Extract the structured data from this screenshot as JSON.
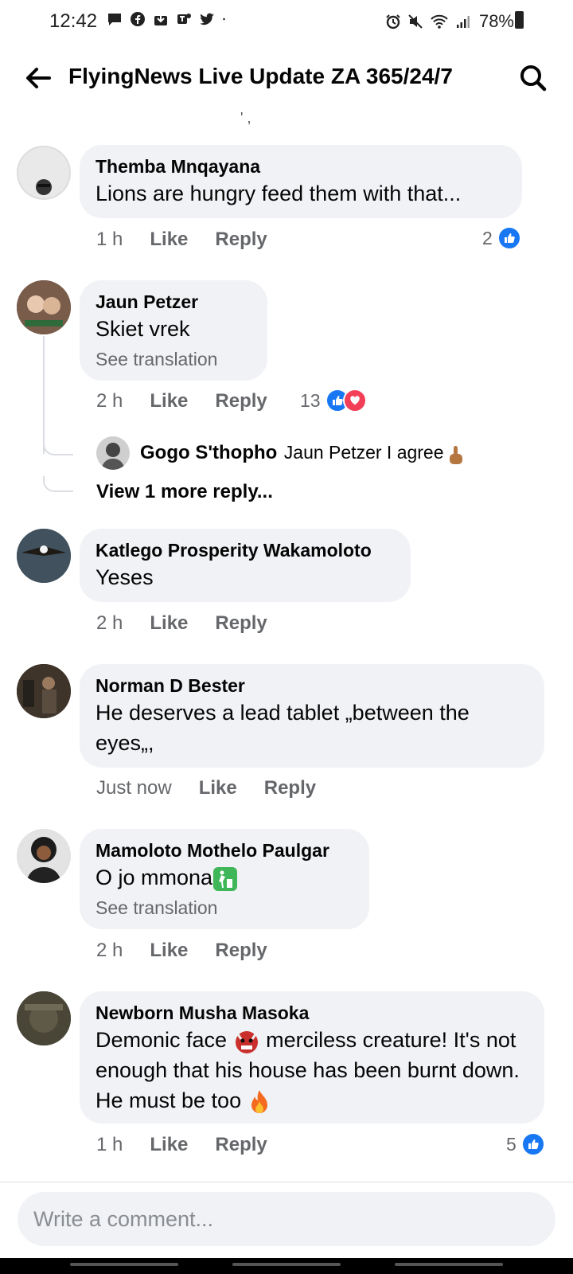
{
  "status_bar": {
    "time": "12:42",
    "battery": "78%"
  },
  "header": {
    "title": "FlyingNews Live Update ZA 365/24/7"
  },
  "comments": [
    {
      "name": "Themba Mnqayana",
      "text": "Lions are hungry feed them with that...",
      "time": "1 h",
      "like": "Like",
      "reply": "Reply",
      "reaction_count": "2"
    },
    {
      "name": "Jaun Petzer",
      "text": "Skiet vrek",
      "translation": "See translation",
      "time": "2 h",
      "like": "Like",
      "reply": "Reply",
      "reaction_count": "13",
      "nested_reply": {
        "name": "Gogo S'thopho",
        "text": "Jaun Petzer I agree"
      },
      "view_more": "View 1 more reply..."
    },
    {
      "name": "Katlego Prosperity Wakamoloto",
      "text": "Yeses",
      "time": "2 h",
      "like": "Like",
      "reply": "Reply"
    },
    {
      "name": "Norman D Bester",
      "text": "He deserves a lead tablet „between the eyes„,",
      "time": "Just now",
      "like": "Like",
      "reply": "Reply"
    },
    {
      "name": "Mamoloto Mothelo Paulgar",
      "text": "O jo mmona",
      "translation": "See translation",
      "time": "2 h",
      "like": "Like",
      "reply": "Reply"
    },
    {
      "name": "Newborn Musha Masoka",
      "text_part1": "Demonic face",
      "text_part2": "merciless creature! It's not enough that his house has been burnt down. He must be too",
      "time": "1 h",
      "like": "Like",
      "reply": "Reply",
      "reaction_count": "5"
    }
  ],
  "composer": {
    "placeholder": "Write a comment..."
  },
  "colors": {
    "accent": "#1877f2",
    "love": "#f33e58",
    "bubble": "#f0f2f5",
    "meta": "#65676b"
  }
}
